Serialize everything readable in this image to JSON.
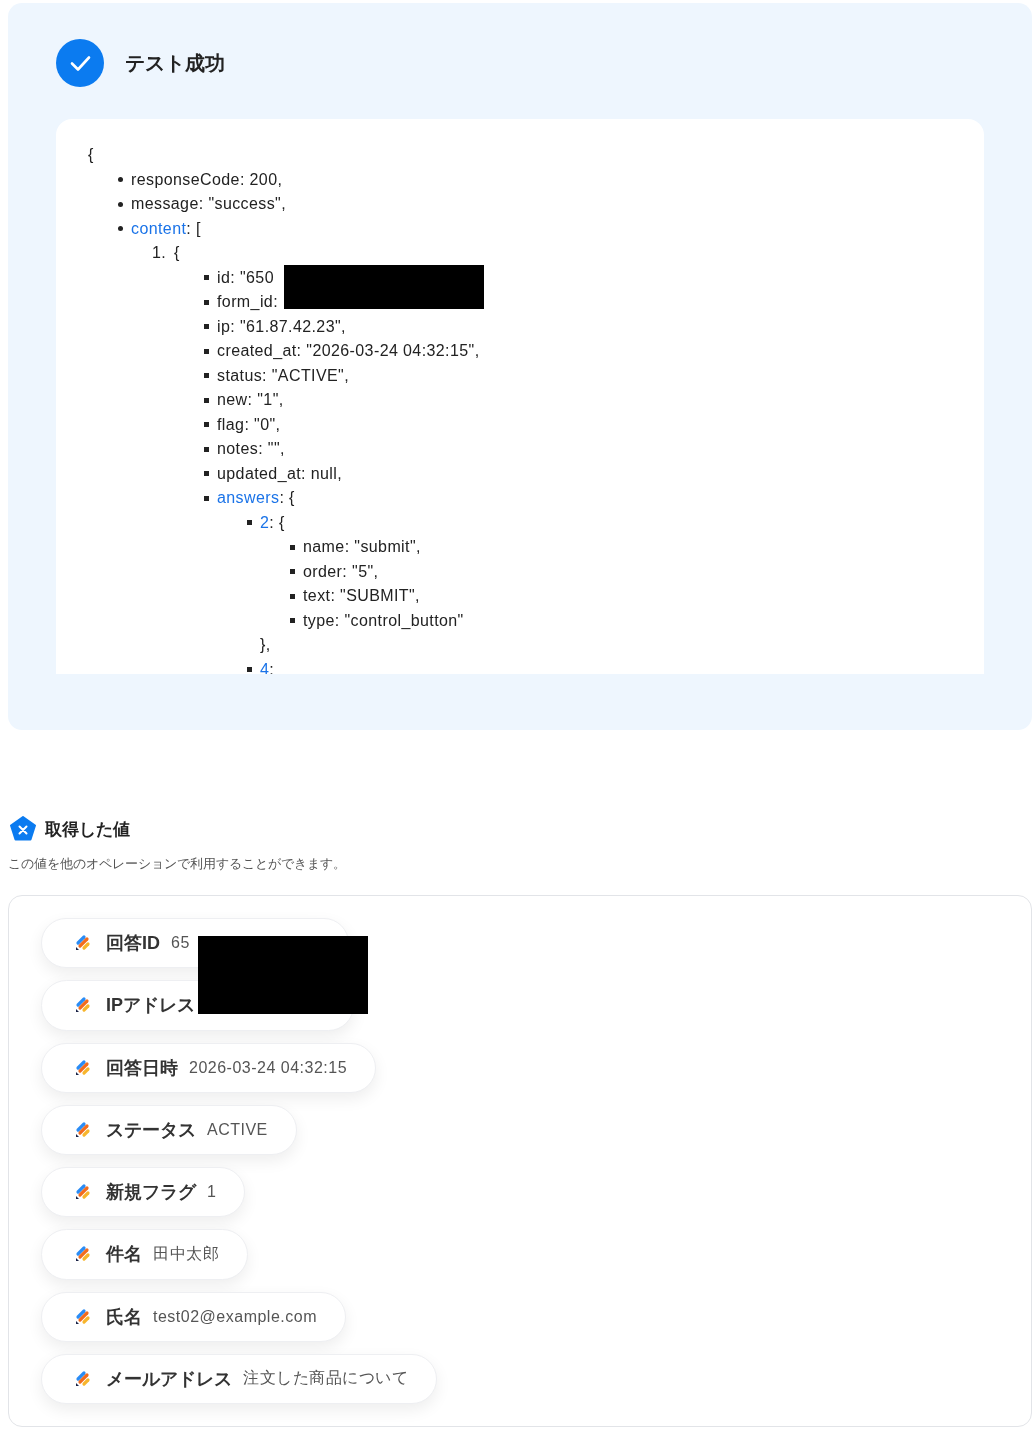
{
  "result": {
    "title": "テスト成功",
    "open": "{",
    "items": [
      {
        "key": "responseCode",
        "value": ": 200,",
        "link": false
      },
      {
        "key": "message",
        "value": ": \"success\",",
        "link": false
      },
      {
        "key": "content",
        "value": ": [",
        "link": true,
        "children": [
          {
            "marker": "1.",
            "value": "{",
            "children": [
              {
                "key": "id",
                "value": ": \"650",
                "link": false
              },
              {
                "key": "form_id",
                "value": ":",
                "link": false
              },
              {
                "key": "ip",
                "value": ": \"61.87.42.23\",",
                "link": false
              },
              {
                "key": "created_at",
                "value": ": \"2026-03-24 04:32:15\",",
                "link": false
              },
              {
                "key": "status",
                "value": ": \"ACTIVE\",",
                "link": false
              },
              {
                "key": "new",
                "value": ": \"1\",",
                "link": false
              },
              {
                "key": "flag",
                "value": ": \"0\",",
                "link": false
              },
              {
                "key": "notes",
                "value": ": \"\",",
                "link": false
              },
              {
                "key": "updated_at",
                "value": ": null,",
                "link": false
              },
              {
                "key": "answers",
                "value": ": {",
                "link": true,
                "children": [
                  {
                    "key": "2",
                    "value": ": {",
                    "link": true,
                    "close": "},",
                    "children": [
                      {
                        "key": "name",
                        "value": ": \"submit\",",
                        "link": false
                      },
                      {
                        "key": "order",
                        "value": ": \"5\",",
                        "link": false
                      },
                      {
                        "key": "text",
                        "value": ": \"SUBMIT\",",
                        "link": false
                      },
                      {
                        "key": "type",
                        "value": ": \"control_button\"",
                        "link": false
                      }
                    ]
                  },
                  {
                    "key": "4",
                    "value": ":",
                    "link": true
                  }
                ]
              }
            ]
          }
        ]
      }
    ]
  },
  "values": {
    "title": "取得した値",
    "description": "この値を他のオペレーションで利用することができます。",
    "pills": [
      {
        "label": "回答ID",
        "value": "65",
        "redacted": true
      },
      {
        "label": "IPアドレス",
        "redacted": true
      },
      {
        "label": "回答日時",
        "value": "2026-03-24 04:32:15"
      },
      {
        "label": "ステータス",
        "value": "ACTIVE"
      },
      {
        "label": "新規フラグ",
        "value": "1"
      },
      {
        "label": "件名",
        "value": "田中太郎"
      },
      {
        "label": "氏名",
        "value": "test02@example.com"
      },
      {
        "label": "メールアドレス",
        "value": "注文した商品について"
      }
    ]
  }
}
